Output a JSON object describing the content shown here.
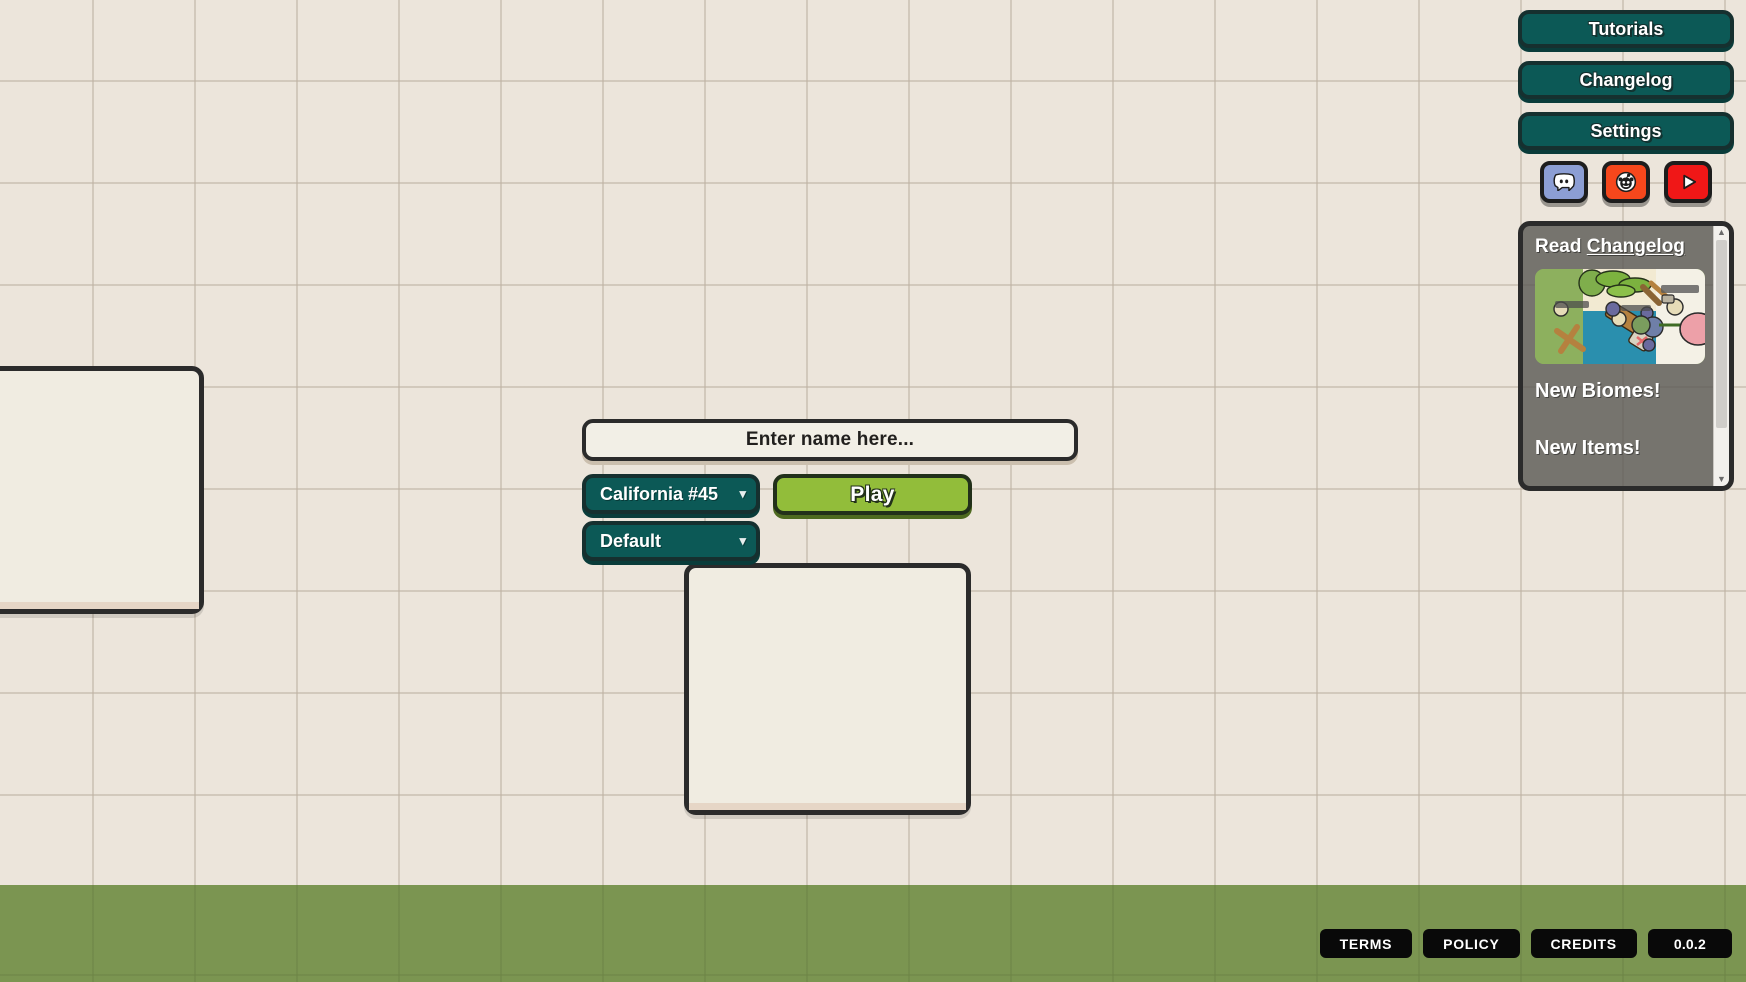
{
  "background": {
    "color": "#ece5db",
    "grid_line_color": "#bdb2a2",
    "ground_color": "#7b9551"
  },
  "play_form": {
    "name_input": {
      "value": "",
      "placeholder": "Enter name here..."
    },
    "server_select": {
      "selected": "California #45",
      "chevron": "chevron-down-icon"
    },
    "gamemode_select": {
      "selected": "Default",
      "chevron": "chevron-down-icon"
    },
    "play_button": {
      "label": "Play",
      "color": "#92bd3a"
    }
  },
  "side_nav": {
    "accent_color": "#0c5956",
    "buttons": [
      {
        "label": "Tutorials"
      },
      {
        "label": "Changelog"
      },
      {
        "label": "Settings"
      }
    ],
    "socials": [
      {
        "name": "discord-icon",
        "color": "#8c9ed4"
      },
      {
        "name": "reddit-icon",
        "color": "#f6471c"
      },
      {
        "name": "youtube-icon",
        "color": "#f01717"
      }
    ]
  },
  "changelog": {
    "title_prefix": "Read ",
    "title_link": "Changelog",
    "thumbnail_alt": "game-screenshot-biomes",
    "entries": [
      {
        "heading": "New Biomes!"
      },
      {
        "heading": "New Items!"
      }
    ],
    "scrollbar": {
      "up_arrow": "▲",
      "down_arrow": "▼"
    }
  },
  "ads": {
    "left_panel_label": "",
    "center_panel_label": ""
  },
  "footer": {
    "buttons": [
      {
        "label": "TERMS"
      },
      {
        "label": "POLICY"
      },
      {
        "label": "CREDITS"
      }
    ],
    "version": "0.0.2"
  }
}
